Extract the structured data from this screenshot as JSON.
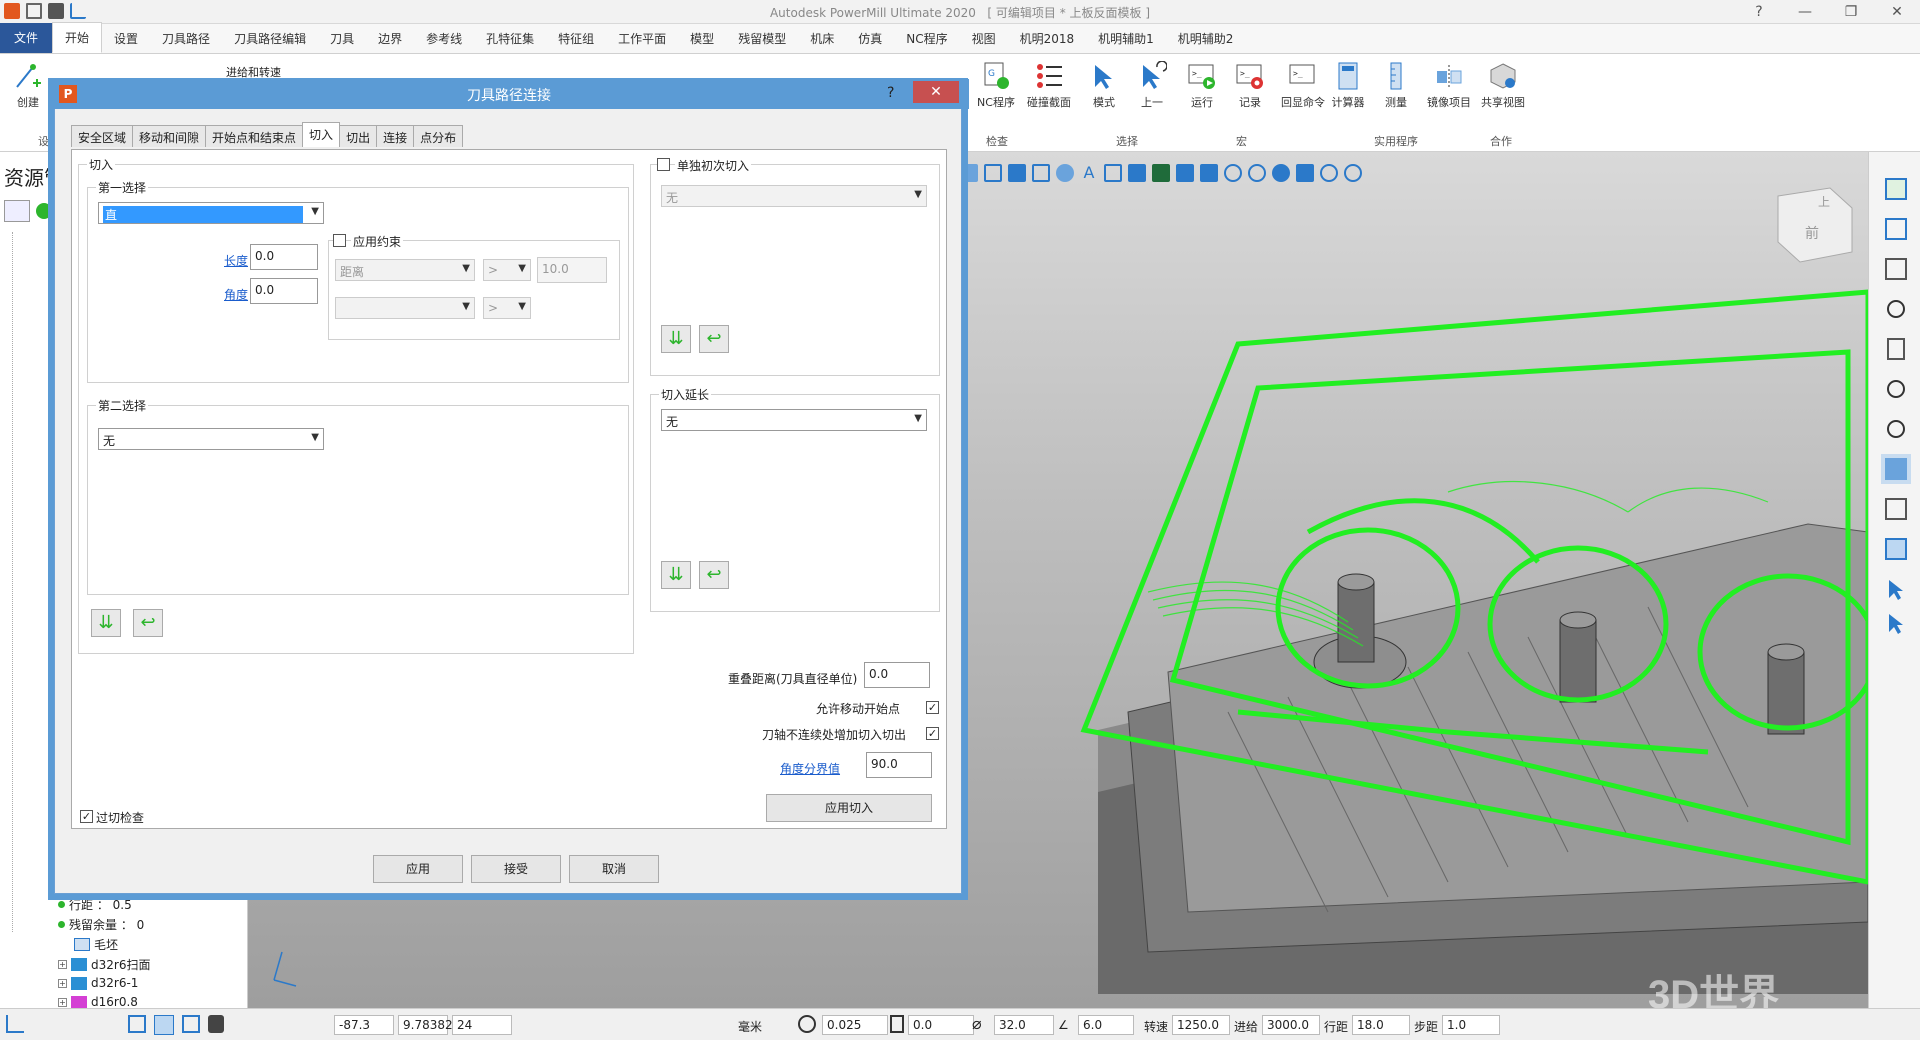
{
  "app": {
    "title": "Autodesk PowerMill Ultimate 2020",
    "project": "[ 可编辑项目 * 上板反面模板 ]"
  },
  "ribbon_tabs": [
    "文件",
    "开始",
    "设置",
    "刀具路径",
    "刀具路径编辑",
    "刀具",
    "边界",
    "参考线",
    "孔特征集",
    "特征组",
    "工作平面",
    "模型",
    "残留模型",
    "机床",
    "仿真",
    "NC程序",
    "视图",
    "机明2018",
    "机明辅助1",
    "机明辅助2"
  ],
  "ribbon": {
    "create": "创建",
    "feed_speed": "进给和转速",
    "nc_program": "NC程序",
    "collision": "碰撞截面",
    "check_label": "检查",
    "mode": "模式",
    "prev": "上一",
    "select_label": "选择",
    "run": "运行",
    "record": "记录",
    "echo": "回显命令",
    "macro_label": "宏",
    "calculator": "计算器",
    "measure": "测量",
    "mirror": "镜像项目",
    "utilities_label": "实用程序",
    "share_view": "共享视图",
    "collab_label": "合作",
    "settings_label": "设"
  },
  "left_panel": {
    "title": "资源管",
    "tree_bottom": [
      {
        "label": "行距 ： 0.5"
      },
      {
        "label": "残留余量 ： 0"
      },
      {
        "label": "毛坯"
      },
      {
        "label": "d32r6扫面"
      },
      {
        "label": "d32r6-1"
      },
      {
        "label": "d16r0.8"
      }
    ]
  },
  "viewport": {
    "cube_label": "前",
    "cube_top": "上"
  },
  "dialog": {
    "title": "刀具路径连接",
    "help": "?",
    "close": "✕",
    "tabs": [
      "安全区域",
      "移动和间隙",
      "开始点和结束点",
      "切入",
      "切出",
      "连接",
      "点分布"
    ],
    "active_tab": "切入",
    "section_label": "切入",
    "first_choice": {
      "label": "第一选择",
      "value": "直",
      "length_label": "长度",
      "length": "0.0",
      "angle_label": "角度",
      "angle": "0.0",
      "apply_constraint": "应用约束",
      "constraint_type": "距离",
      "constraint_op": ">",
      "constraint_value": "10.0",
      "constraint_op2": ">"
    },
    "second_choice": {
      "label": "第二选择",
      "value": "无"
    },
    "single_first": {
      "label": "单独初次切入",
      "value": "无"
    },
    "extension": {
      "label": "切入延长",
      "value": "无"
    },
    "overlap_label": "重叠距离(刀具直径单位)",
    "overlap": "0.0",
    "allow_move_start": "允许移动开始点",
    "axis_discont": "刀轴不连续处增加切入切出",
    "angle_threshold_label": "角度分界值",
    "angle_threshold": "90.0",
    "apply_leadin": "应用切入",
    "gouge_check": "过切检查",
    "apply": "应用",
    "accept": "接受",
    "cancel": "取消"
  },
  "statusbar": {
    "x": "-87.3",
    "y": "9.78382",
    "z": "24",
    "unit": "毫米",
    "tol": "0.025",
    "stock": "0.0",
    "dia": "32.0",
    "angle": "6.0",
    "speed_label": "转速",
    "speed": "1250.0",
    "feed_label": "进给",
    "feed": "3000.0",
    "stepover_label": "行距",
    "stepover": "18.0",
    "stepdown_label": "步距",
    "stepdown": "1.0"
  },
  "watermark": "3D世界"
}
